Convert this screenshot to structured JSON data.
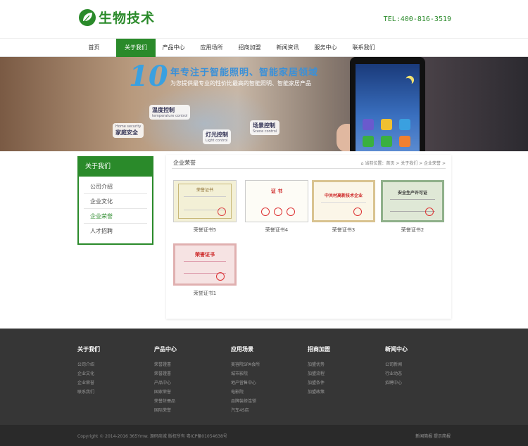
{
  "header": {
    "logo_text": "生物技术",
    "tel": "TEL:400-816-3519"
  },
  "nav": [
    "首页",
    "关于我们",
    "产品中心",
    "应用场所",
    "招商加盟",
    "新闻资讯",
    "服务中心",
    "联系我们"
  ],
  "nav_active": "关于我们",
  "banner": {
    "number": "10",
    "title": "年专注于智能照明、智能家居领域",
    "subtitle": "为您提供最专业的性价比最高的智能照明、智能家居产品",
    "bubbles": [
      {
        "big": "温度控制",
        "small": "temperature control"
      },
      {
        "big": "家庭安全",
        "small": "Home security"
      },
      {
        "big": "灯光控制",
        "small": "Light control"
      },
      {
        "big": "场景控制",
        "small": "Scene control"
      }
    ]
  },
  "sidebar": {
    "title": "关于我们",
    "items": [
      "公司介绍",
      "企业文化",
      "企业荣誉",
      "人才招聘"
    ],
    "active": "企业荣誉"
  },
  "content": {
    "title": "企业荣誉",
    "breadcrumb": "当前位置：首页 > 关于我们 > 企业荣誉 >",
    "items": [
      {
        "label": "荣誉证书5",
        "cert_title": "荣誉证书"
      },
      {
        "label": "荣誉证书4",
        "cert_title": "证 书"
      },
      {
        "label": "荣誉证书3",
        "cert_title": "中关村高新技术企业"
      },
      {
        "label": "荣誉证书2",
        "cert_title": "安全生产许可证"
      },
      {
        "label": "荣誉证书1",
        "cert_title": "荣誉证书"
      }
    ]
  },
  "footer": {
    "columns": [
      {
        "title": "关于我们",
        "links": [
          "公司介绍",
          "企业文化",
          "企业荣誉",
          "联系我们"
        ]
      },
      {
        "title": "产品中心",
        "links": [
          "荣誉證書",
          "荣誉證書",
          "产品中心",
          "国家荣誉",
          "荣誉註冊品",
          "国际荣誉"
        ]
      },
      {
        "title": "应用场景",
        "links": [
          "美容院SPA会所",
          "城市影院",
          "地产营售中心",
          "电影院",
          "品牌装修连锁",
          "汽车4S店"
        ]
      },
      {
        "title": "招商加盟",
        "links": [
          "加盟优势",
          "加盟流程",
          "加盟条件",
          "加盟政策"
        ]
      },
      {
        "title": "新闻中心",
        "links": [
          "公司新闻",
          "行业动态",
          "招聘中心"
        ]
      }
    ],
    "copyright": "Copyright © 2014-2016 365Ymw. 源码商城 版权所有   粤ICP备01054638号",
    "right_links": "新闻简报  提示简报"
  },
  "colors": {
    "brand_green": "#2a8a2a",
    "footer_bg": "#363636"
  }
}
